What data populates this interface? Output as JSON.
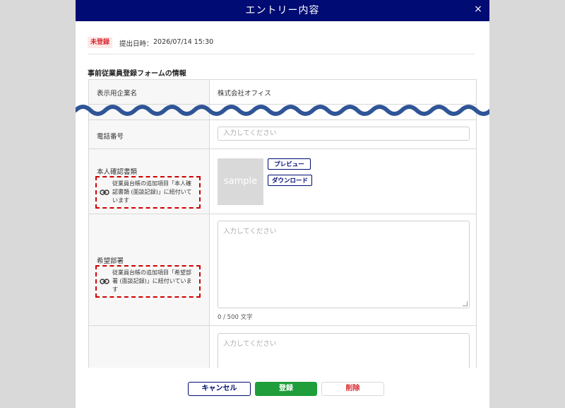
{
  "modal": {
    "title": "エントリー内容",
    "close_label": "×"
  },
  "status": {
    "badge": "未登録",
    "submitted_label": "提出日時：",
    "submitted_value": "2026/07/14 15:30"
  },
  "section": {
    "title": "事前従業員登録フォームの情報"
  },
  "rows": {
    "company": {
      "label": "表示用企業名",
      "value": "株式会社オフィス"
    },
    "phone": {
      "label": "電話番号",
      "placeholder": "入力してください"
    },
    "id_document": {
      "label": "本人確認書類",
      "linked_note": "従業員台帳の追加項目「本人確認書類 (面談記録)」に紐付いています",
      "thumbnail_text": "sample",
      "preview_label": "プレビュー",
      "download_label": "ダウンロード"
    },
    "department": {
      "label": "希望部署",
      "linked_note": "従業員台帳の追加項目「希望部署 (面談記録)」に紐付いています",
      "placeholder": "入力してください",
      "char_count": "0 / 500 文字"
    },
    "extra": {
      "placeholder": "入力してください"
    }
  },
  "footer": {
    "cancel_label": "キャンセル",
    "register_label": "登録",
    "delete_label": "削除"
  },
  "colors": {
    "header_bg": "#000b73",
    "register": "#1f9e3b",
    "danger": "#d8262c",
    "highlight_dash": "#d00000",
    "wave": "#2f5597"
  },
  "icons": {
    "close": "close-icon",
    "link": "link-icon"
  }
}
